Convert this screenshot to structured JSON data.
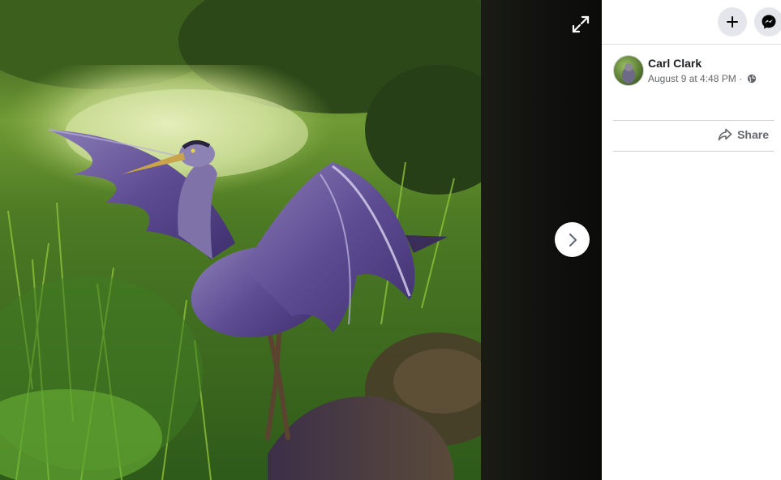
{
  "post": {
    "author": "Carl Clark",
    "date": "August 9 at 4:48 PM ·",
    "share_label": "Share"
  },
  "icons": {
    "expand": "expand-icon",
    "next": "chevron-right-icon",
    "add": "plus-icon",
    "messenger": "messenger-icon",
    "globe": "globe-icon",
    "share": "share-icon"
  },
  "colors": {
    "sidebar_bg": "#ffffff",
    "button_gray": "#e4e6eb",
    "meta_text": "#65676b"
  }
}
